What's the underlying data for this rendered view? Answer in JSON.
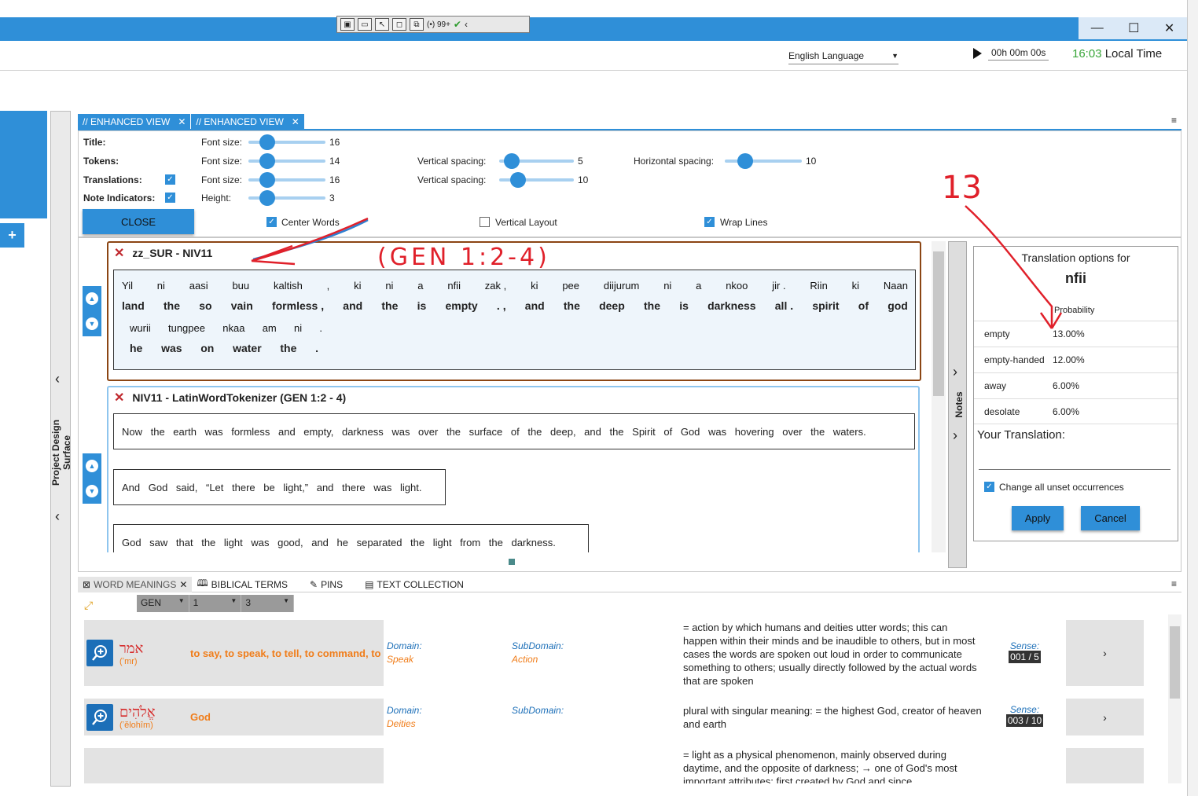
{
  "topbar": {
    "badge": "99+",
    "language": "English Language",
    "timer": "00h 00m 00s",
    "clock_time": "16:03",
    "clock_label": "Local Time"
  },
  "sidebar": {
    "label": "Project Design Surface",
    "plus": "+"
  },
  "tabs": [
    {
      "label": "// ENHANCED VIEW"
    },
    {
      "label": "// ENHANCED VIEW"
    }
  ],
  "settings": {
    "title_label": "Title:",
    "tokens_label": "Tokens:",
    "translations_label": "Translations:",
    "note_indicators_label": "Note Indicators:",
    "font_size_label": "Font size:",
    "height_label": "Height:",
    "vertical_spacing_label": "Vertical spacing:",
    "horizontal_spacing_label": "Horizontal spacing:",
    "title_font_size": "16",
    "tokens_font_size": "14",
    "translations_font_size": "16",
    "note_height": "3",
    "tokens_vertical_spacing": "5",
    "translations_vertical_spacing": "10",
    "horizontal_spacing": "10",
    "close_label": "CLOSE",
    "center_words_label": "Center Words",
    "vertical_layout_label": "Vertical Layout",
    "wrap_lines_label": "Wrap Lines",
    "center_words": true,
    "vertical_layout": false,
    "wrap_lines": true
  },
  "verse1": {
    "title": "zz_SUR - NIV11",
    "row1_src": [
      "Yil",
      "ni",
      "aasi",
      "buu",
      "kaltish",
      ",",
      "ki",
      "ni",
      "a",
      "nfii",
      "zak ,",
      "ki",
      "pee",
      "diijurum",
      "ni",
      "a",
      "nkoo",
      "jir .",
      "Riin",
      "ki",
      "Naan"
    ],
    "row1_trg": [
      "land",
      "the",
      "so",
      "vain",
      "formless ,",
      "and",
      "the",
      "is",
      "empty",
      ". ,",
      "and",
      "the",
      "deep",
      "the",
      "is",
      "darkness",
      "all .",
      "spirit",
      "of",
      "god"
    ],
    "row2_src": [
      "wurii",
      "tungpee",
      "nkaa",
      "am",
      "ni",
      "."
    ],
    "row2_trg": [
      "he",
      "was",
      "on",
      "water",
      "the",
      "."
    ]
  },
  "verse2": {
    "title": "NIV11 - LatinWordTokenizer (GEN 1:2 - 4)",
    "sentences": [
      "Now the earth was formless and empty, darkness was over the surface of the deep, and the Spirit of God was hovering over the waters.",
      "And God said, “Let there be light,” and there was light.",
      "God saw that the light was good, and he separated the light from the darkness."
    ]
  },
  "notes_label": "Notes",
  "translation_panel": {
    "header": "Translation options for",
    "word": "nfii",
    "probability_label": "Probability",
    "options": [
      {
        "word": "empty",
        "prob": "13.00%"
      },
      {
        "word": "empty-handed",
        "prob": "12.00%"
      },
      {
        "word": "away",
        "prob": "6.00%"
      },
      {
        "word": "desolate",
        "prob": "6.00%"
      }
    ],
    "your_translation_label": "Your Translation:",
    "change_all_label": "Change all unset occurrences",
    "apply_label": "Apply",
    "cancel_label": "Cancel"
  },
  "bottom_tabs": [
    {
      "label": "WORD MEANINGS"
    },
    {
      "label": "BIBLICAL TERMS"
    },
    {
      "label": "PINS"
    },
    {
      "label": "TEXT COLLECTION"
    }
  ],
  "filters": {
    "book": "GEN",
    "chapter": "1",
    "verse": "3"
  },
  "word_meanings": [
    {
      "hebrew": "אמר",
      "translit": "(ʼmr)",
      "gloss": "to say, to speak, to tell, to command, to",
      "domain_label": "Domain:",
      "domain": "Speak",
      "subdomain_label": "SubDomain:",
      "subdomain": "Action",
      "definition": "= action by which humans and deities utter words; this can happen within their minds and be inaudible to others, but in most cases the words are spoken out loud in order to communicate something to others; usually directly followed by the actual words that are spoken",
      "sense_label": "Sense:",
      "sense": "001 / 5"
    },
    {
      "hebrew": "אֱלֹהִים",
      "translit": "(ʼĕlohîm)",
      "gloss": "God",
      "domain_label": "Domain:",
      "domain": "Deities",
      "subdomain_label": "SubDomain:",
      "subdomain": "",
      "definition": "plural with singular meaning: = the highest God, creator of heaven and earth",
      "sense_label": "Sense:",
      "sense": "003 / 10"
    },
    {
      "definition": "= light as a physical phenomenon, mainly observed during daytime, and the opposite of darkness; → one of God's most important attributes; first created by God and since"
    }
  ],
  "annotations": {
    "gen_ref": "(GEN 1:2-4)",
    "number": "13"
  },
  "colors": {
    "accent": "#2f8fd8",
    "verse1_border": "#8b4513",
    "hebrew": "#d62b2b",
    "gloss": "#f07d1a",
    "annotation": "#e0202a"
  }
}
